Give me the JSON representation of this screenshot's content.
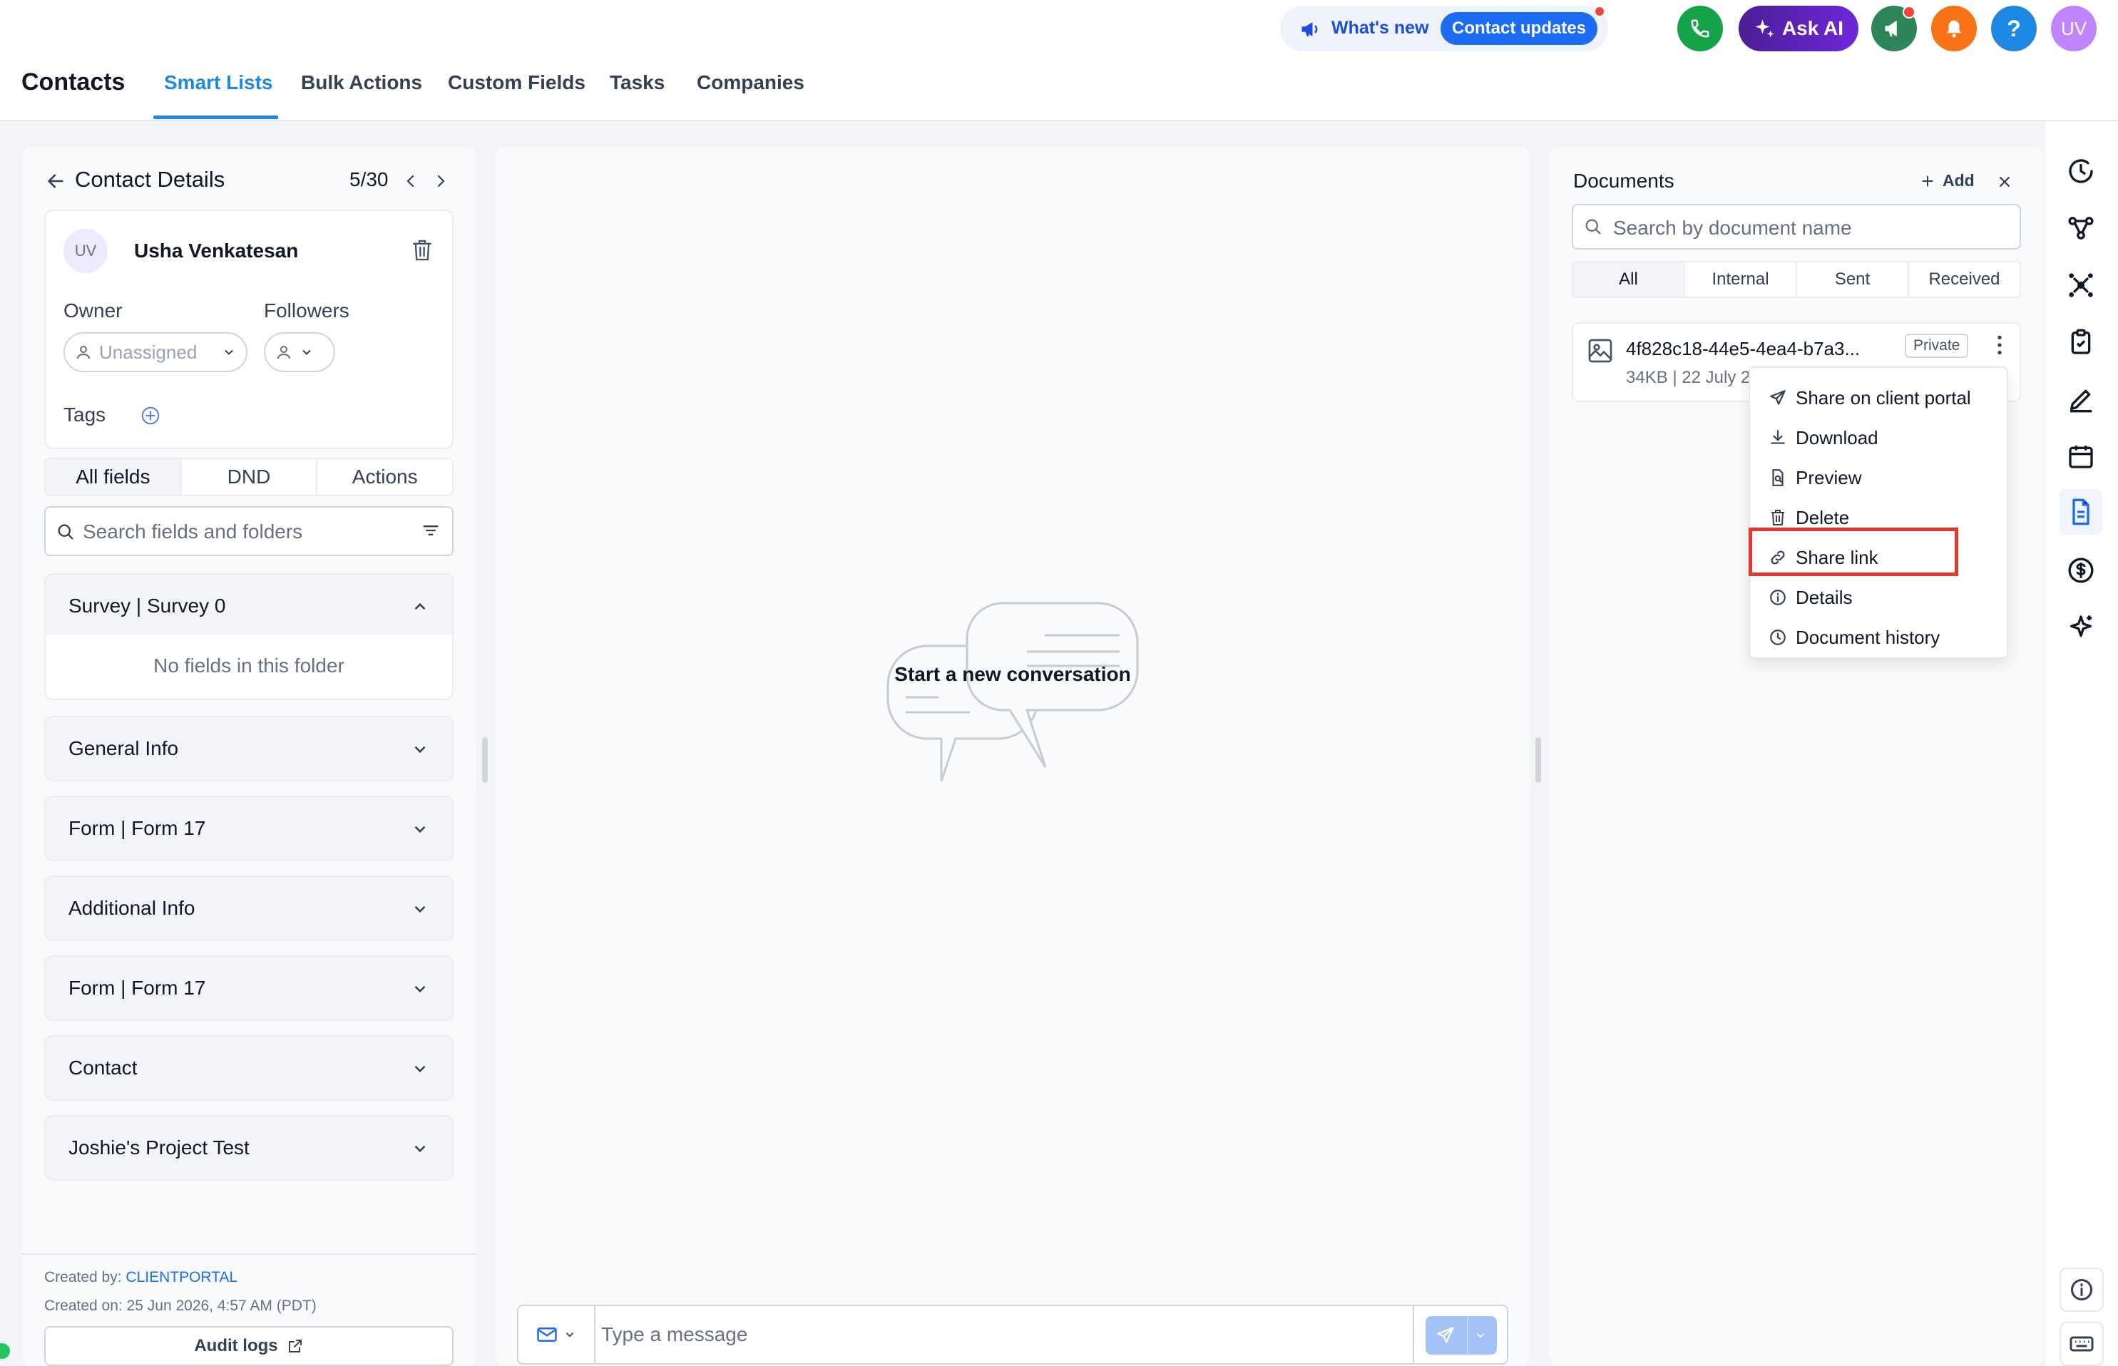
{
  "header": {
    "app_title": "Contacts",
    "nav_tabs": [
      {
        "label": "Smart Lists",
        "active": true
      },
      {
        "label": "Bulk Actions"
      },
      {
        "label": "Custom Fields"
      },
      {
        "label": "Tasks"
      },
      {
        "label": "Companies"
      }
    ],
    "whats_new_label": "What's new",
    "contact_updates_label": "Contact updates",
    "ask_ai_label": "Ask AI",
    "help_label": "?",
    "avatar_initials": "UV",
    "colors": {
      "accent": "#1e88e5",
      "phone": "#16a34a",
      "askai": "#5b21b6",
      "announce": "#2f855a",
      "bell": "#f97316",
      "help": "#1e88e5",
      "avatar": "#c084fc"
    }
  },
  "contact_panel": {
    "title": "Contact Details",
    "position": "5/30",
    "avatar_initials": "UV",
    "name": "Usha Venkatesan",
    "owner_label": "Owner",
    "owner_value": "Unassigned",
    "followers_label": "Followers",
    "tags_label": "Tags",
    "tabs": [
      {
        "label": "All fields",
        "active": true
      },
      {
        "label": "DND"
      },
      {
        "label": "Actions"
      }
    ],
    "search_placeholder": "Search fields and folders",
    "sections": [
      {
        "label": "Survey | Survey 0",
        "expanded": true
      },
      {
        "label": "General Info"
      },
      {
        "label": "Form | Form 17"
      },
      {
        "label": "Additional Info"
      },
      {
        "label": "Form | Form 17"
      },
      {
        "label": "Contact"
      },
      {
        "label": "Joshie's Project Test"
      }
    ],
    "empty_folder_text": "No fields in this folder",
    "created_by_label": "Created by: ",
    "created_by_value": "CLIENTPORTAL",
    "created_on": "Created on: 25 Jun 2026, 4:57 AM (PDT)",
    "audit_logs_label": "Audit logs"
  },
  "conversation": {
    "empty_title": "Start a new conversation",
    "message_placeholder": "Type a message"
  },
  "documents": {
    "title": "Documents",
    "add_label": "Add",
    "search_placeholder": "Search by document name",
    "tabs": [
      {
        "label": "All",
        "active": true
      },
      {
        "label": "Internal"
      },
      {
        "label": "Sent"
      },
      {
        "label": "Received"
      }
    ],
    "items": [
      {
        "name": "4f828c18-44e5-4ea4-b7a3...",
        "meta": "34KB | 22 July 2",
        "badge": "Private"
      }
    ],
    "menu": [
      {
        "label": "Share on client portal",
        "icon": "send-icon"
      },
      {
        "label": "Download",
        "icon": "download-icon"
      },
      {
        "label": "Preview",
        "icon": "preview-icon"
      },
      {
        "label": "Delete",
        "icon": "trash-icon"
      },
      {
        "label": "Share link",
        "icon": "link-icon",
        "highlighted": true
      },
      {
        "label": "Details",
        "icon": "info-icon"
      },
      {
        "label": "Document history",
        "icon": "clock-icon"
      }
    ]
  },
  "right_rail": {
    "icons": [
      "activity-icon",
      "workflow-icon",
      "people-network-icon",
      "clipboard-check-icon",
      "pen-icon",
      "calendar-icon",
      "document-icon",
      "dollar-icon",
      "sparkle-icon"
    ],
    "active_icon": "document-icon",
    "bottom_icons": [
      "info-icon",
      "keyboard-icon"
    ]
  }
}
